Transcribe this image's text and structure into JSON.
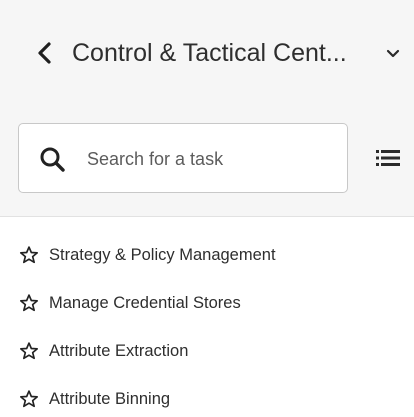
{
  "header": {
    "title": "Control & Tactical Cent...",
    "back_icon": "chevron-left-icon",
    "dropdown_icon": "chevron-down-icon"
  },
  "search": {
    "placeholder": "Search for a task",
    "value": "",
    "icon": "search-icon",
    "list_toggle_icon": "list-icon"
  },
  "tasks": [
    {
      "label": "Strategy & Policy Management",
      "icon": "star-outline-icon"
    },
    {
      "label": "Manage Credential Stores",
      "icon": "star-outline-icon"
    },
    {
      "label": "Attribute Extraction",
      "icon": "star-outline-icon"
    },
    {
      "label": "Attribute Binning",
      "icon": "star-outline-icon"
    }
  ],
  "colors": {
    "header_bg": "#f6f6f6",
    "text": "#2e2e2e",
    "border": "#c8c8c8"
  }
}
